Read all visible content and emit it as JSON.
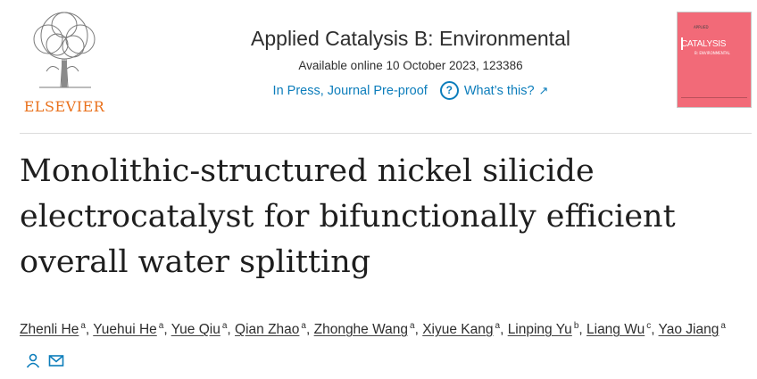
{
  "publisher": {
    "name": "ELSEVIER"
  },
  "journal": {
    "title": "Applied Catalysis B: Environmental",
    "available": "Available online 10 October 2023, 123386",
    "status": "In Press, Journal Pre-proof",
    "whats_this": "What’s this?"
  },
  "cover": {
    "line1": "APPLIED",
    "line2": "CATALYSIS",
    "line3": "B: ENVIRONMENTAL"
  },
  "article": {
    "title": "Monolithic-structured nickel silicide electrocatalyst for bifunctionally efficient overall water splitting"
  },
  "authors": [
    {
      "name": "Zhenli He",
      "aff": "a"
    },
    {
      "name": "Yuehui He",
      "aff": "a"
    },
    {
      "name": "Yue Qiu",
      "aff": "a"
    },
    {
      "name": "Qian Zhao",
      "aff": "a"
    },
    {
      "name": "Zhonghe Wang",
      "aff": "a"
    },
    {
      "name": "Xiyue Kang",
      "aff": "a"
    },
    {
      "name": "Linping Yu",
      "aff": "b"
    },
    {
      "name": "Liang Wu",
      "aff": "c"
    },
    {
      "name": "Yao Jiang",
      "aff": "a"
    }
  ],
  "colors": {
    "link": "#0c7dbb",
    "elsevier_orange": "#e9711c",
    "cover_pink": "#f26a78"
  },
  "icons": [
    "person-icon",
    "envelope-icon",
    "help-circle-icon",
    "external-arrow-icon"
  ]
}
